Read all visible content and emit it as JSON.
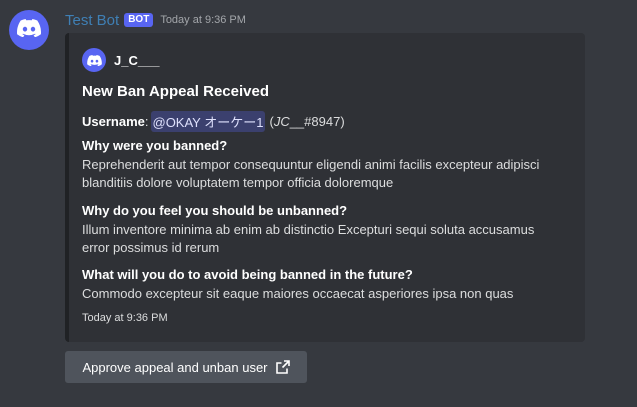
{
  "message": {
    "author": "Test Bot",
    "bot_tag": "BOT",
    "timestamp": "Today at 9:36 PM",
    "avatar_icon": "discord-logo-icon"
  },
  "embed": {
    "author_name": "J_C___",
    "author_icon": "discord-logo-icon",
    "title": "New Ban Appeal Received",
    "username_label": "Username",
    "username_sep": ":",
    "username_mention": "@OKAY オーケー1",
    "username_tag_open": "(",
    "username_tag_italic": "JC",
    "username_tag_rest": "__#8947)",
    "fields": [
      {
        "name": "Why were you banned?",
        "value": "Reprehenderit aut tempor consequuntur eligendi animi facilis excepteur adipisci blanditiis dolore voluptatem tempor officia doloremque"
      },
      {
        "name": "Why do you feel you should be unbanned?",
        "value": "Illum inventore minima ab enim ab distinctio Excepturi sequi soluta accusamus error possimus id rerum"
      },
      {
        "name": "What will you do to avoid being banned in the future?",
        "value": "Commodo excepteur sit eaque maiores occaecat asperiores ipsa non quas"
      }
    ],
    "footer": "Today at 9:36 PM",
    "accent_color": "#202225"
  },
  "button": {
    "label": "Approve appeal and unban user",
    "icon": "external-link-icon"
  },
  "colors": {
    "background": "#36393f",
    "embed_bg": "#2f3136",
    "button_bg": "#4f545c",
    "author_color": "#3f7fb4",
    "bot_tag_bg": "#5865f2"
  }
}
